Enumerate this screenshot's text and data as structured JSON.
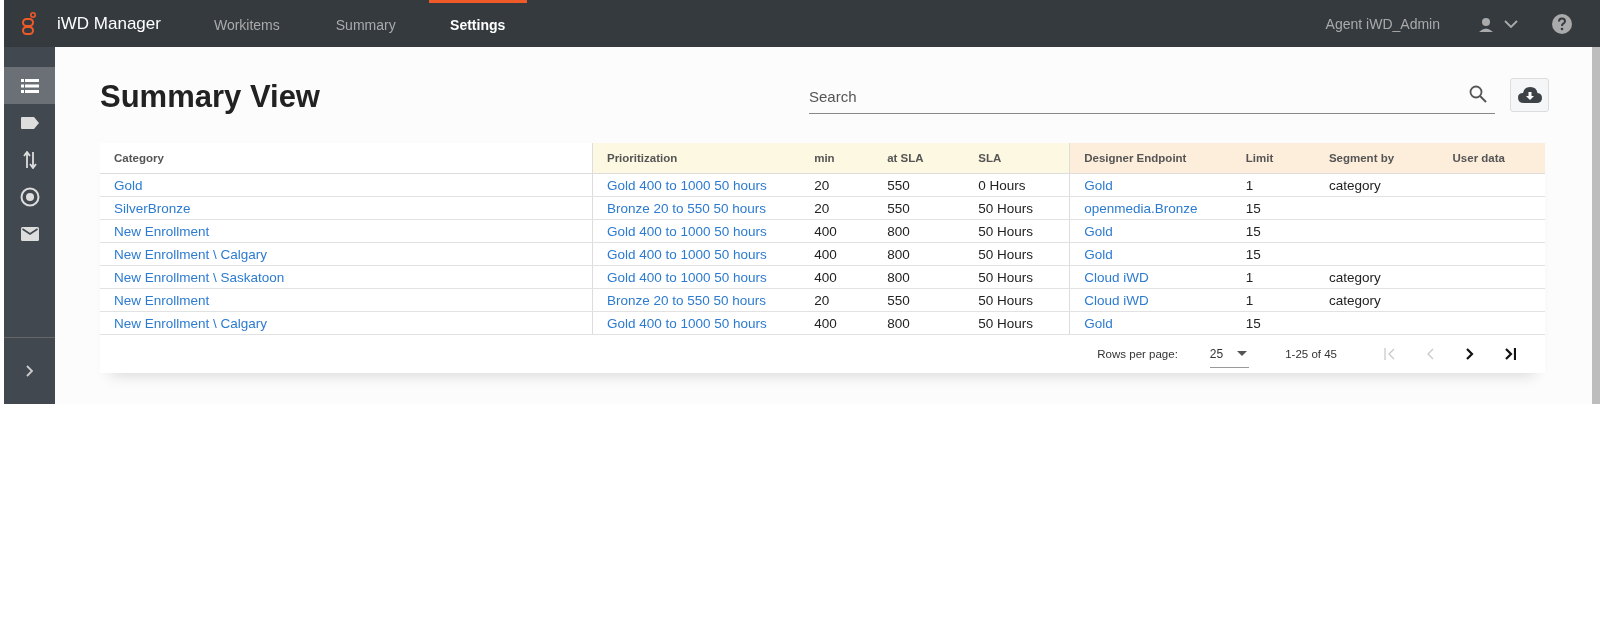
{
  "header": {
    "app_title": "iWD Manager",
    "tabs": [
      {
        "label": "Workitems",
        "selected": false
      },
      {
        "label": "Summary",
        "selected": false
      },
      {
        "label": "Settings",
        "selected": true
      }
    ],
    "user": "Agent iWD_Admin"
  },
  "sidebar": {
    "items": [
      {
        "selected": true
      },
      {
        "selected": false
      },
      {
        "selected": false
      },
      {
        "selected": false
      },
      {
        "selected": false
      }
    ]
  },
  "page_title": "Summary View",
  "search": {
    "placeholder": "Search"
  },
  "table": {
    "columns": [
      {
        "label": "Category",
        "kind": "link",
        "color": "#ffffff"
      },
      {
        "label": "Prioritization",
        "kind": "link",
        "color": "#fdf8e1"
      },
      {
        "label": "min",
        "kind": "text",
        "color": "#fdf8e1"
      },
      {
        "label": "at SLA",
        "kind": "text",
        "color": "#fdf8e1"
      },
      {
        "label": "SLA",
        "kind": "text",
        "color": "#fdf8e1"
      },
      {
        "label": "Designer Endpoint",
        "kind": "link",
        "color": "#fdeedc"
      },
      {
        "label": "Limit",
        "kind": "text",
        "color": "#fdeedc"
      },
      {
        "label": "Segment by",
        "kind": "text",
        "color": "#fdeedc"
      },
      {
        "label": "User data",
        "color": "#fdeedc"
      }
    ],
    "rows": [
      {
        "cells": [
          "Gold",
          "Gold 400 to 1000 50 hours",
          "20",
          "550",
          "0 Hours",
          "Gold",
          "1",
          "category"
        ]
      },
      {
        "cells": [
          "SilverBronze",
          "Bronze 20 to 550 50 hours",
          "20",
          "550",
          "50 Hours",
          "openmedia.Bronze",
          "15"
        ]
      },
      {
        "cells": [
          "New Enrollment",
          "Gold 400 to 1000 50 hours",
          "400",
          "800",
          "50 Hours",
          "Gold",
          "15"
        ]
      },
      {
        "cells": [
          "New Enrollment \\ Calgary",
          "Gold 400 to 1000 50 hours",
          "400",
          "800",
          "50 Hours",
          "Gold",
          "15"
        ]
      },
      {
        "cells": [
          "New Enrollment \\ Saskatoon",
          "Gold 400 to 1000 50 hours",
          "400",
          "800",
          "50 Hours",
          "Cloud iWD",
          "1",
          "category"
        ]
      },
      {
        "cells": [
          "New Enrollment",
          "Bronze 20 to 550 50 hours",
          "20",
          "550",
          "50 Hours",
          "Cloud iWD",
          "1",
          "category"
        ]
      },
      {
        "cells": [
          "New Enrollment \\ Calgary",
          "Gold 400 to 1000 50 hours",
          "400",
          "800",
          "50 Hours",
          "Gold",
          "15"
        ]
      }
    ]
  },
  "pagination": {
    "rows_per_page_label": "Rows per page:",
    "rows_per_page": "25",
    "range": "1-25 of 45",
    "buttons": [
      {
        "kind": "first",
        "disabled": true
      },
      {
        "kind": "prev",
        "disabled": true
      },
      {
        "kind": "next",
        "disabled": false
      },
      {
        "kind": "last",
        "disabled": false
      }
    ]
  }
}
